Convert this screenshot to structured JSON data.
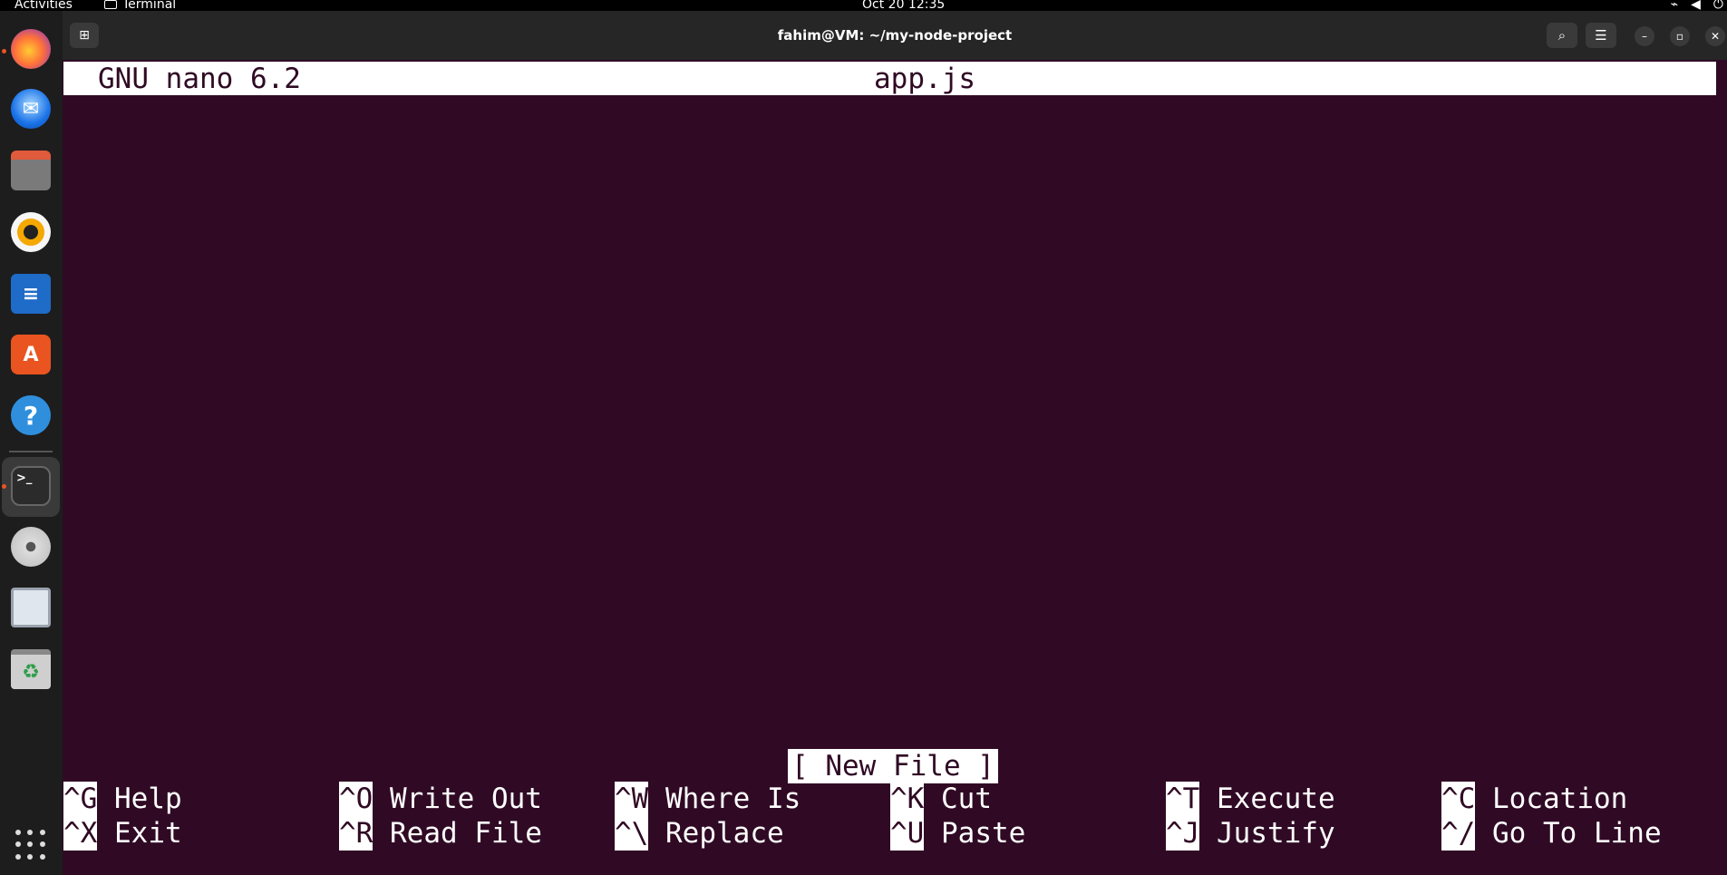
{
  "topbar": {
    "activities": "Activities",
    "app_name": "Terminal",
    "clock": "Oct 20  12:35"
  },
  "window": {
    "title": "fahim@VM: ~/my-node-project"
  },
  "nano": {
    "version": "GNU nano 6.2",
    "filename": "app.js",
    "status": "[ New File ]",
    "shortcuts": [
      {
        "key": "^G",
        "label": "Help"
      },
      {
        "key": "^O",
        "label": "Write Out"
      },
      {
        "key": "^W",
        "label": "Where Is"
      },
      {
        "key": "^K",
        "label": "Cut"
      },
      {
        "key": "^T",
        "label": "Execute"
      },
      {
        "key": "^C",
        "label": "Location"
      },
      {
        "key": "^X",
        "label": "Exit"
      },
      {
        "key": "^R",
        "label": "Read File"
      },
      {
        "key": "^\\",
        "label": "Replace"
      },
      {
        "key": "^U",
        "label": "Paste"
      },
      {
        "key": "^J",
        "label": "Justify"
      },
      {
        "key": "^/",
        "label": "Go To Line"
      }
    ]
  },
  "dock": {
    "apps": [
      "firefox-icon",
      "thunderbird-icon",
      "files-icon",
      "rhythmbox-icon",
      "writer-icon",
      "app-center-icon",
      "help-icon",
      "terminal-icon",
      "disc-icon",
      "save-icon",
      "trash-icon"
    ]
  },
  "colors": {
    "terminal_bg": "#300a24",
    "accent": "#e95420"
  }
}
